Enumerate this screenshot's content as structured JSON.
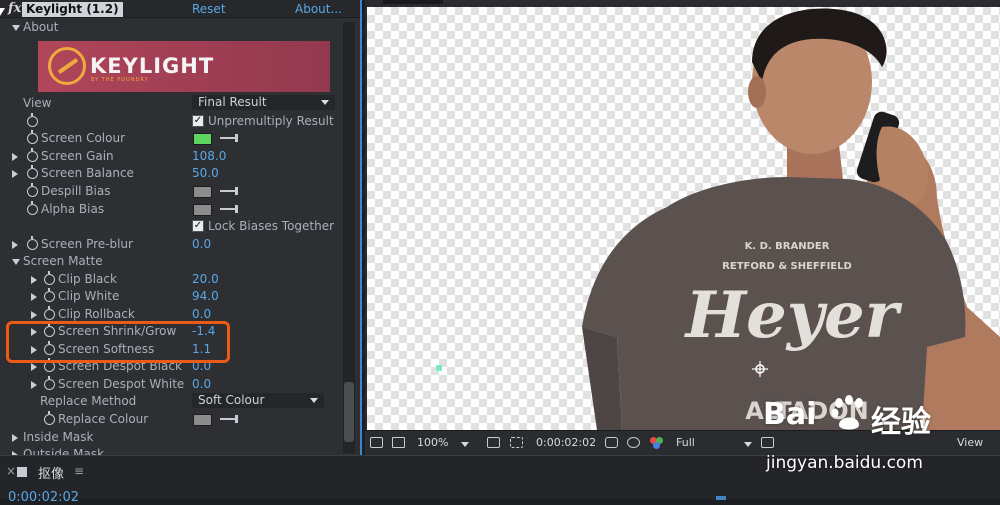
{
  "effect_controls": {
    "fx_badge": "fx",
    "effect_name": "Keylight (1.2)",
    "reset_label": "Reset",
    "about_label": "About...",
    "about_section": "About",
    "banner_text": "KEYLIGHT",
    "banner_subtext": "BY THE FOUNDRY",
    "view": {
      "label": "View",
      "value": "Final Result"
    },
    "unpremultiply": {
      "label": "Unpremultiply Result",
      "checked": true
    },
    "screen_colour": {
      "label": "Screen Colour",
      "color": "#5fd35f"
    },
    "screen_gain": {
      "label": "Screen Gain",
      "value": "108.0"
    },
    "screen_balance": {
      "label": "Screen Balance",
      "value": "50.0"
    },
    "despill_bias": {
      "label": "Despill Bias",
      "color": "#8c8c8c"
    },
    "alpha_bias": {
      "label": "Alpha Bias",
      "color": "#8c8c8c"
    },
    "lock_biases": {
      "label": "Lock Biases Together",
      "checked": true
    },
    "screen_preblur": {
      "label": "Screen Pre-blur",
      "value": "0.0"
    },
    "screen_matte": {
      "label": "Screen Matte",
      "clip_black": {
        "label": "Clip Black",
        "value": "20.0"
      },
      "clip_white": {
        "label": "Clip White",
        "value": "94.0"
      },
      "clip_rollback": {
        "label": "Clip Rollback",
        "value": "0.0"
      },
      "screen_shrink_grow": {
        "label": "Screen Shrink/Grow",
        "value": "-1.4"
      },
      "screen_softness": {
        "label": "Screen Softness",
        "value": "1.1"
      },
      "screen_despot_black": {
        "label": "Screen Despot Black",
        "value": "0.0"
      },
      "screen_despot_white": {
        "label": "Screen Despot White",
        "value": "0.0"
      },
      "replace_method": {
        "label": "Replace Method",
        "value": "Soft Colour"
      },
      "replace_colour": {
        "label": "Replace Colour",
        "color": "#8c8c8c"
      }
    },
    "inside_mask": {
      "label": "Inside Mask"
    },
    "outside_mask": {
      "label": "Outside Mask"
    }
  },
  "viewer": {
    "zoom": "100%",
    "timecode": "0:00:02:02",
    "resolution": "Full",
    "view_label": "View",
    "shirt_text_top": "K. D. BRANDER",
    "shirt_text_sub": "RETFORD & SHEFFIELD",
    "shirt_text_main": "Heyer",
    "shirt_text_bottom": "ALTADON"
  },
  "timeline": {
    "close_glyph": "×",
    "title": "抠像",
    "menu_glyph": "≡",
    "current_time": "0:00:02:02"
  },
  "watermark": {
    "brand_a": "Bai",
    "brand_b": "经验",
    "url": "jingyan.baidu.com"
  },
  "colors": {
    "accent_blue": "#5aa7e6",
    "highlight": "#ec5a17",
    "banner": "#a9435a"
  }
}
